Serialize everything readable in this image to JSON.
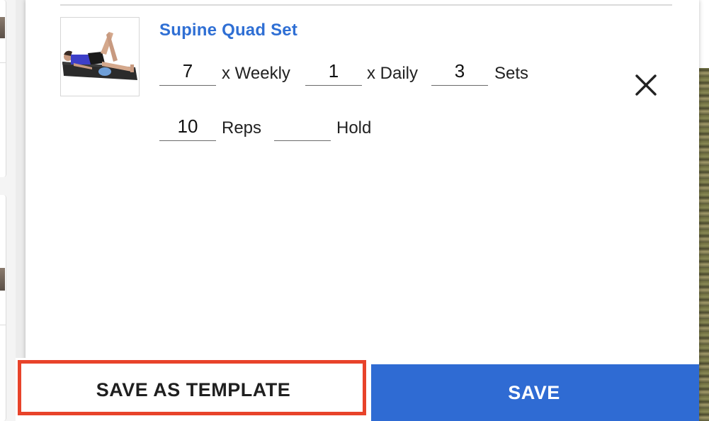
{
  "exercise": {
    "title": "Supine Quad Set",
    "image_icon": "supine-exercise-photo",
    "frequency": {
      "weekly_value": "7",
      "weekly_label": "x Weekly",
      "daily_value": "1",
      "daily_label": "x Daily",
      "sets_value": "3",
      "sets_label": "Sets",
      "reps_value": "10",
      "reps_label": "Reps",
      "hold_value": "",
      "hold_label": "Hold"
    },
    "remove_icon": "close-icon"
  },
  "footer": {
    "save_template_label": "SAVE AS TEMPLATE",
    "save_label": "SAVE",
    "save_color": "#2f6bd3",
    "highlight_color": "#e8432a"
  },
  "colors": {
    "title": "#2f6fd4"
  }
}
